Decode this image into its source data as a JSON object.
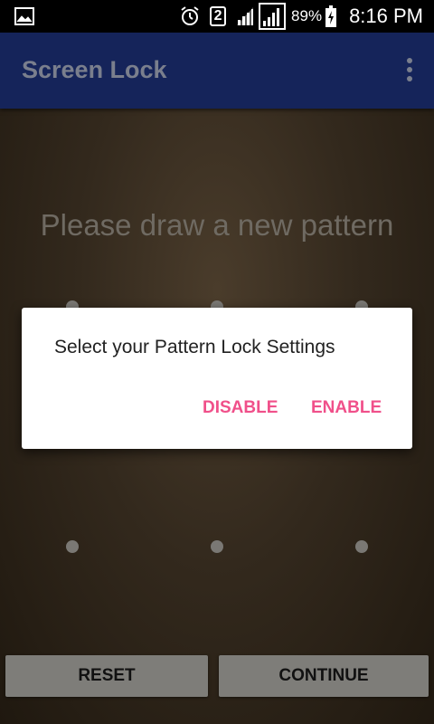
{
  "status_bar": {
    "sim_slot": "2",
    "battery": "89%",
    "time": "8:16 PM",
    "icons": [
      "gallery-icon",
      "alarm-icon",
      "sim-2-icon",
      "signal-icon",
      "signal-icon",
      "battery-charging-icon"
    ]
  },
  "app_bar": {
    "title": "Screen Lock",
    "menu_icon": "overflow-menu-icon"
  },
  "main": {
    "prompt": "Please draw a new pattern",
    "pattern_dots": 9
  },
  "dialog": {
    "message": "Select your Pattern Lock Settings",
    "disable_label": "DISABLE",
    "enable_label": "ENABLE",
    "accent_color": "#f0508a"
  },
  "footer": {
    "reset_label": "RESET",
    "continue_label": "CONTINUE"
  },
  "colors": {
    "app_bar": "#15245a",
    "status_bar": "#000000",
    "button": "#7e7d79"
  }
}
